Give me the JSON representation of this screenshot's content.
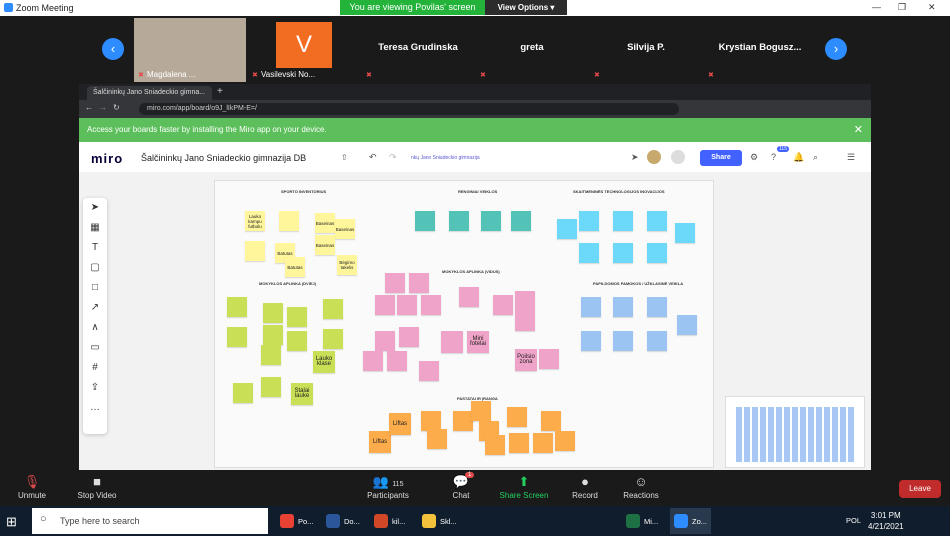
{
  "zoom": {
    "window_title": "Zoom Meeting",
    "viewing_banner": "You are viewing Povilas' screen",
    "view_options": "View Options",
    "participants": [
      {
        "name": "Magdalena ..."
      },
      {
        "name": "Vasilevski No...",
        "initial": "V"
      },
      {
        "name": "Teresa Grudinska"
      },
      {
        "name": "greta"
      },
      {
        "name": "Silvija P."
      },
      {
        "name": "Krystian Bogusz..."
      }
    ],
    "toolbar": {
      "unmute": "Unmute",
      "stop_video": "Stop Video",
      "participants": "Participants",
      "participants_count": "115",
      "chat": "Chat",
      "chat_badge": "1",
      "share": "Share Screen",
      "record": "Record",
      "reactions": "Reactions",
      "leave": "Leave"
    }
  },
  "browser": {
    "tab_title": "Šalčininkų Jano Sniadeckio gimna...",
    "url": "miro.com/app/board/o9J_lIkPM-E=/",
    "banner": "Access your boards faster by installing the Miro app on your device.",
    "banner_link": "installing the Miro app"
  },
  "miro": {
    "logo": "miro",
    "board_name": "Šalčininkų Jano Sniadeckio gimnazija DB",
    "breadcrumb": "nkų Jano Sniadeckio gimnazija",
    "share": "Share",
    "badge": "115",
    "groups": {
      "sport": "SPORTO INVENTORIUS",
      "renginiai": "RENGINIAI VEIKLOS",
      "skaitmenines": "SKAITMENINĖS TECHNOLOGIJOS INOVACIJOS",
      "aplinka": "MOKYKLOS APLINKA (DVIEJ)",
      "mokyklos_aplinka_vidus": "MOKYKLOS APLINKA (VIDUS)",
      "papildomos": "PAPILDOMOS PAMOKOS / UŽKLASINĖ VEIKLA",
      "pastatai": "PASTATAI IR ĮRANGA"
    },
    "notes": {
      "lauko_kamp": "Lauko kampu futbolu",
      "batutas1": "Batutas",
      "batutas2": "Batutas",
      "baseinas1": "Baseinas",
      "baseinas2": "Baseinas",
      "baseinas3": "Baseinas",
      "begimo": "Bėgimo takelis",
      "lauko_klase": "Lauko klase",
      "stalai": "Stalai lauke",
      "mini_futbol": "Mini futbolo",
      "poilsio": "Poilsio zona",
      "mini_fotel": "Mini fotelai",
      "liftas1": "Liftas",
      "liftas2": "Liftas",
      "patalpos": "Paplildomos klasės"
    }
  },
  "taskbar": {
    "search_placeholder": "Type here to search",
    "apps": [
      "Po...",
      "Do...",
      "kil...",
      "Skl...",
      "Mi...",
      "Zo..."
    ],
    "time": "3:01 PM",
    "date": "4/21/2021",
    "lang": "POL"
  }
}
